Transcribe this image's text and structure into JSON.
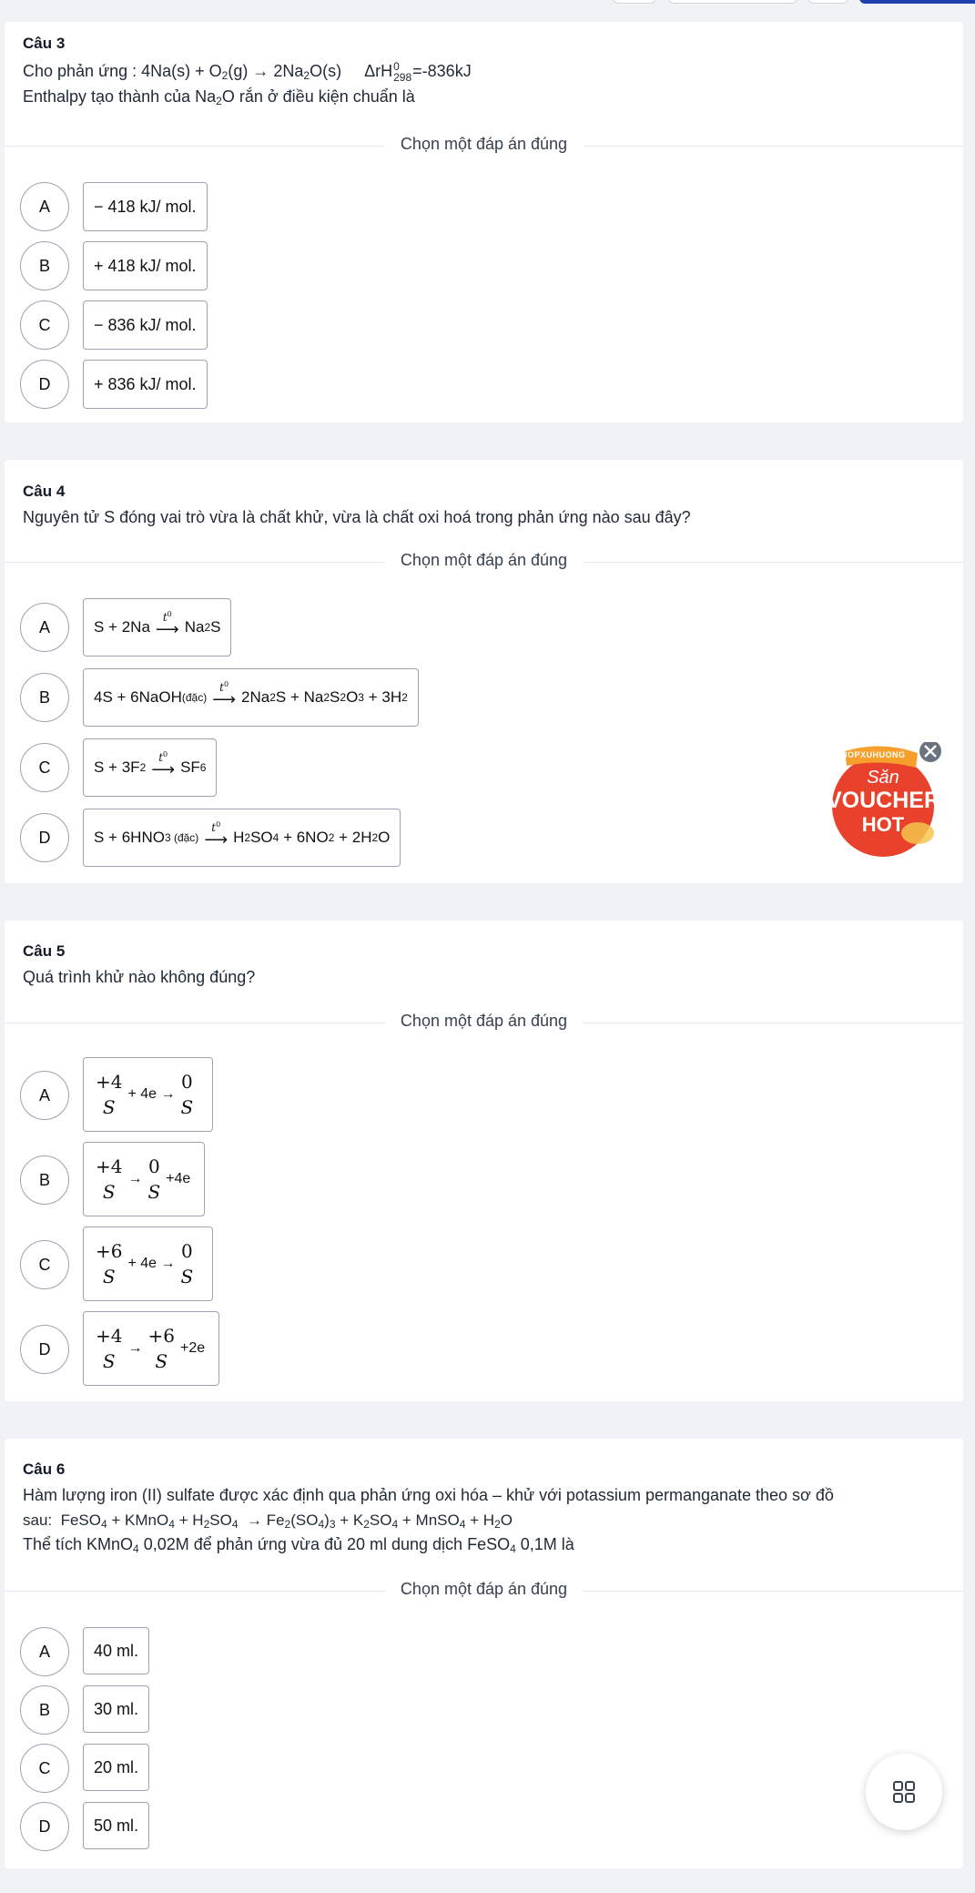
{
  "choose_label": "Chọn một đáp án đúng",
  "q3": {
    "title": "Câu 3",
    "line1_a": "Cho phản ứng : 4Na(s) + O",
    "line1_sub": "2",
    "line1_b": "(g) → 2Na",
    "line1_sub2": "2",
    "line1_c": "O(s)",
    "line1_delta": "ΔrH",
    "line1_delta_sup": "0",
    "line1_delta_sub": "298",
    "line1_value": "=-836kJ",
    "line2_a": "Enthalpy tạo thành của Na",
    "line2_sub": "2",
    "line2_b": "O rắn ở điều kiện chuẩn là",
    "options": [
      {
        "letter": "A",
        "text": "− 418 kJ/ mol."
      },
      {
        "letter": "B",
        "text": "+ 418 kJ/ mol."
      },
      {
        "letter": "C",
        "text": "− 836 kJ/ mol."
      },
      {
        "letter": "D",
        "text": "+ 836 kJ/ mol."
      }
    ]
  },
  "q4": {
    "title": "Câu 4",
    "text": "Nguyên tử S đóng vai trò vừa là chất khử, vừa là chất oxi hoá trong phản ứng nào sau đây?",
    "letters": [
      "A",
      "B",
      "C",
      "D"
    ],
    "arrow_label": "t",
    "arrow_sup": "0",
    "optA": {
      "left": "S + 2Na",
      "right": "Na",
      "right_sub": "2",
      "right_end": "S"
    },
    "optB": {
      "left": "4S + 6NaOH",
      "left_sub": "(đặc)",
      "right": "2Na",
      "r1": "2",
      "r2": "S + Na",
      "r3": "2",
      "r4": "S",
      "r5": "2",
      "r6": "O",
      "r7": "3",
      "r8": " + 3H",
      "r9": "2"
    },
    "optC": {
      "left": "S + 3F",
      "left_sub": "2",
      "right": "SF",
      "right_sub": "6"
    },
    "optD": {
      "left": "S + 6HNO",
      "left_sub": "3 (đặc)",
      "right": "H",
      "r1": "2",
      "r2": "SO",
      "r3": "4",
      "r4": " + 6NO",
      "r5": "2",
      "r6": " + 2H",
      "r7": "2",
      "r8": "O"
    }
  },
  "q5": {
    "title": "Câu 5",
    "text": "Quá trình khử nào không đúng?",
    "options": [
      {
        "letter": "A",
        "n1": "+4",
        "s1": "S",
        "mid": "+ 4e →",
        "n2": "0",
        "s2": "S",
        "end": ""
      },
      {
        "letter": "B",
        "n1": "+4",
        "s1": "S",
        "mid": "→",
        "n2": "0",
        "s2": "S",
        "end": "+4e"
      },
      {
        "letter": "C",
        "n1": "+6",
        "s1": "S",
        "mid": "+ 4e →",
        "n2": "0",
        "s2": "S",
        "end": ""
      },
      {
        "letter": "D",
        "n1": "+4",
        "s1": "S",
        "mid": "→",
        "n2": "+6",
        "s2": "S",
        "end": "+2e"
      }
    ]
  },
  "q6": {
    "title": "Câu 6",
    "line1": "Hàm lượng iron (II) sulfate được xác định qua phản ứng oxi hóa – khử với potassium permanganate theo sơ đồ",
    "line2": {
      "a": "sau:  FeSO",
      "b": "4",
      "c": " + KMnO",
      "d": "4",
      "e": " + H",
      "f": "2",
      "g": "SO",
      "h": "4",
      "i": "  → Fe",
      "j": "2",
      "k": "(SO",
      "l": "4",
      "m": ")",
      "n": "3",
      "o": " + K",
      "p": "2",
      "q": "SO",
      "r": "4",
      "s": " + MnSO",
      "t": "4",
      "u": " + H",
      "v": "2",
      "w": "O"
    },
    "line3": {
      "a": "Thể tích KMnO",
      "b": "4",
      "c": " 0,02M để phản ứng vừa đủ 20 ml dung dịch FeSO",
      "d": "4",
      "e": " 0,1M là"
    },
    "options": [
      {
        "letter": "A",
        "text": "40 ml."
      },
      {
        "letter": "B",
        "text": "30 ml."
      },
      {
        "letter": "C",
        "text": "20 ml."
      },
      {
        "letter": "D",
        "text": "50 ml."
      }
    ]
  },
  "voucher": {
    "brand": "#SHOPXUHUONG",
    "line1": "Săn",
    "line2": "VOUCHER",
    "line3": "HOT"
  },
  "colors": {
    "accent": "#1e40af",
    "voucher_red": "#e8412c",
    "voucher_orange": "#f6a02b"
  }
}
